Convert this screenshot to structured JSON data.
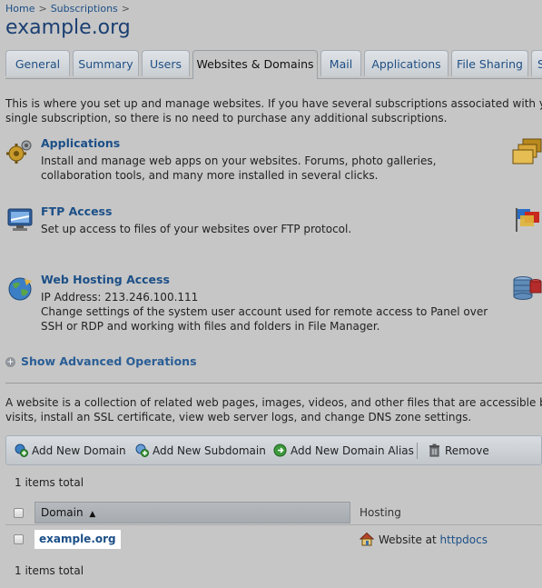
{
  "breadcrumb": {
    "items": [
      "Home",
      "Subscriptions"
    ],
    "separator": ">"
  },
  "page_title": "example.org",
  "tabs": [
    {
      "label": "General",
      "active": false
    },
    {
      "label": "Summary",
      "active": false
    },
    {
      "label": "Users",
      "active": false
    },
    {
      "label": "Websites & Domains",
      "active": true
    },
    {
      "label": "Mail",
      "active": false
    },
    {
      "label": "Applications",
      "active": false
    },
    {
      "label": "File Sharing",
      "active": false
    },
    {
      "label": "S",
      "active": false
    }
  ],
  "intro": {
    "line1": "This is where you set up and manage websites. If you have several subscriptions associated with you",
    "line2": "single subscription, so there is no need to purchase any additional subscriptions."
  },
  "tools": {
    "applications": {
      "title": "Applications",
      "desc1": "Install and manage web apps on your websites. Forums, photo galleries,",
      "desc2": "collaboration tools, and many more installed in several clicks."
    },
    "ftp": {
      "title": "FTP Access",
      "desc1": "Set up access to files of your websites over FTP protocol."
    },
    "hosting": {
      "title": "Web Hosting Access",
      "ip": "IP Address: 213.246.100.111",
      "desc1": "Change settings of the system user account used for remote access to Panel over",
      "desc2": "SSH or RDP and working with files and folders in File Manager."
    }
  },
  "advanced": {
    "label": "Show Advanced Operations",
    "icon": "plus-circle-icon"
  },
  "website_intro": {
    "line1": "A website is a collection of related web pages, images, videos, and other files that are accessible by",
    "line2": "visits, install an SSL certificate, view web server logs, and change DNS zone settings."
  },
  "toolbar": {
    "add_domain": "Add New Domain",
    "add_subdomain": "Add New Subdomain",
    "add_alias": "Add New Domain Alias",
    "remove": "Remove"
  },
  "list": {
    "total_top": "1 items total",
    "total_bottom": "1 items total",
    "columns": {
      "domain": "Domain",
      "sort_indicator": "▲",
      "hosting": "Hosting"
    },
    "rows": [
      {
        "domain": "example.org",
        "hosting_prefix": "Website at",
        "hosting_link": "httpdocs"
      }
    ]
  },
  "colors": {
    "link": "#1c4f87",
    "background": "#c6c6c6",
    "title": "#1a3f72"
  }
}
